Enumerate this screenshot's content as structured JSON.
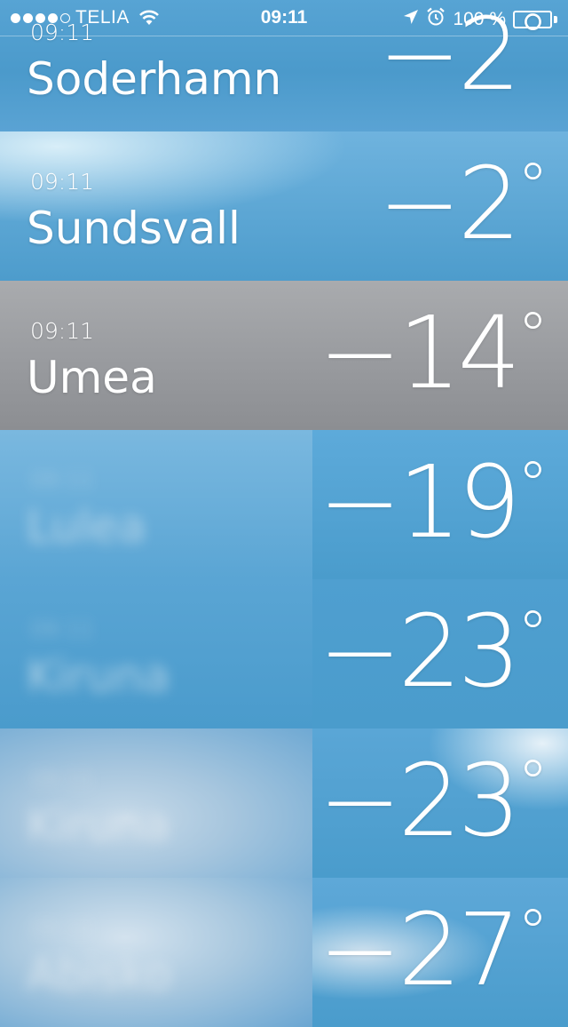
{
  "status_bar": {
    "carrier": "TELIA",
    "time": "09:11",
    "battery": "100 %",
    "signal_bars_filled": 4,
    "signal_bars_total": 5
  },
  "cities": [
    {
      "time": "09:11",
      "name": "Soderhamn",
      "temp": "−2",
      "degree": "°"
    },
    {
      "time": "09:11",
      "name": "Sundsvall",
      "temp": "−2",
      "degree": "°"
    },
    {
      "time": "09:11",
      "name": "Umea",
      "temp": "−14",
      "degree": "°"
    },
    {
      "time": "09:11",
      "name": "Lulea",
      "temp": "−19",
      "degree": "°"
    },
    {
      "time": "09:11",
      "name": "Kiruna",
      "temp": "−23",
      "degree": "°"
    },
    {
      "time": "09:11",
      "name": "Kiruna",
      "temp": "−23",
      "degree": "°"
    },
    {
      "time": "09:11",
      "name": "Abisko",
      "temp": "−27",
      "degree": "°"
    }
  ],
  "colors": {
    "sky_blue": "#4a9ccc",
    "cloudy_gray": "#9a9ca0"
  }
}
